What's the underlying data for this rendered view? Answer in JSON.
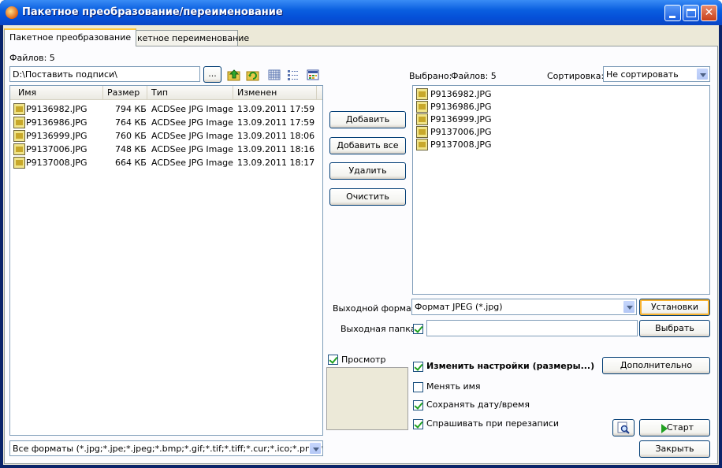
{
  "window": {
    "title": "Пакетное преобразование/переименование"
  },
  "tabs": [
    {
      "label": "Пакетное преобразование",
      "active": true
    },
    {
      "label": "Пакетное переименование",
      "active": false
    }
  ],
  "left": {
    "files_count": "Файлов: 5",
    "path": "D:\\Поставить подписи\\",
    "browse_label": "...",
    "toolbar_icons": [
      "folder-up-icon",
      "refresh-icon",
      "large-icons-view-icon",
      "details-view-icon",
      "thumbnails-view-icon"
    ],
    "columns": [
      "Имя",
      "Размер",
      "Тип",
      "Изменен"
    ],
    "rows": [
      {
        "name": "P9136982.JPG",
        "size": "794 КБ",
        "type": "ACDSee JPG Image",
        "modified": "13.09.2011 17:59"
      },
      {
        "name": "P9136986.JPG",
        "size": "764 КБ",
        "type": "ACDSee JPG Image",
        "modified": "13.09.2011 17:59"
      },
      {
        "name": "P9136999.JPG",
        "size": "760 КБ",
        "type": "ACDSee JPG Image",
        "modified": "13.09.2011 18:06"
      },
      {
        "name": "P9137006.JPG",
        "size": "748 КБ",
        "type": "ACDSee JPG Image",
        "modified": "13.09.2011 18:16"
      },
      {
        "name": "P9137008.JPG",
        "size": "664 КБ",
        "type": "ACDSee JPG Image",
        "modified": "13.09.2011 18:17"
      }
    ],
    "filter": "Все форматы (*.jpg;*.jpe;*.jpeg;*.bmp;*.gif;*.tif;*.tiff;*.cur;*.ico;*.png;*"
  },
  "middle": {
    "add": "Добавить",
    "add_all": "Добавить все",
    "remove": "Удалить",
    "clear": "Очистить",
    "preview_label": "Просмотр",
    "preview_checked": true
  },
  "right": {
    "selected_label": "Выбрано:",
    "selected_count": "Файлов: 5",
    "sort_label": "Сортировка:",
    "sort_value": "Не сортировать",
    "files": [
      "P9136982.JPG",
      "P9136986.JPG",
      "P9136999.JPG",
      "P9137006.JPG",
      "P9137008.JPG"
    ],
    "output_format_label": "Выходной формат:",
    "output_format": "Формат JPEG (*.jpg)",
    "settings": "Установки",
    "output_folder_label": "Выходная папка:",
    "output_folder_checked": true,
    "output_folder": "",
    "choose": "Выбрать",
    "options": [
      {
        "label": "Изменить настройки (размеры...)",
        "checked": true,
        "bold": true
      },
      {
        "label": "Менять имя",
        "checked": false,
        "bold": false
      },
      {
        "label": "Сохранять дату/время",
        "checked": true,
        "bold": false
      },
      {
        "label": "Спрашивать при перезаписи",
        "checked": true,
        "bold": false
      }
    ],
    "advanced": "Дополнительно",
    "start": "Старт",
    "close": "Закрыть"
  },
  "colors": {
    "accent": "#0a5fe0",
    "tab_highlight": "#ffc83c",
    "start_arrow": "#21a121"
  }
}
